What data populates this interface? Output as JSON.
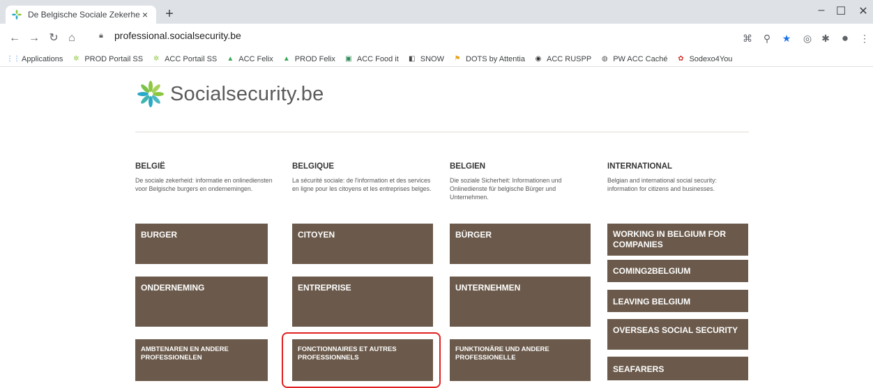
{
  "browser": {
    "tab_title": "De Belgische Sociale Zekerheid |",
    "url": "professional.socialsecurity.be",
    "bookmarks": [
      {
        "label": "Applications",
        "icon": "apps-grid-icon"
      },
      {
        "label": "PROD Portail SS",
        "icon": "socialsecurity-icon"
      },
      {
        "label": "ACC Portail SS",
        "icon": "socialsecurity-icon"
      },
      {
        "label": "ACC Felix",
        "icon": "felix-icon"
      },
      {
        "label": "PROD Felix",
        "icon": "felix-icon"
      },
      {
        "label": "ACC Food it",
        "icon": "food-icon"
      },
      {
        "label": "SNOW",
        "icon": "snow-icon"
      },
      {
        "label": "DOTS by Attentia",
        "icon": "attentia-icon"
      },
      {
        "label": "ACC RUSPP",
        "icon": "ruspp-icon"
      },
      {
        "label": "PW ACC Caché",
        "icon": "globe-icon"
      },
      {
        "label": "Sodexo4You",
        "icon": "sodexo-icon"
      }
    ]
  },
  "site": {
    "name": "Socialsecurity.be"
  },
  "columns": [
    {
      "heading": "BELGIË",
      "description": "De sociale zekerheid: informatie en onlinediensten voor Belgische burgers en ondernemingen.",
      "buttons": [
        "BURGER",
        "ONDERNEMING",
        "AMBTENAREN EN ANDERE PROFESSIONELEN"
      ]
    },
    {
      "heading": "BELGIQUE",
      "description": "La sécurité sociale: de l'information et des services en ligne pour les citoyens et les entreprises belges.",
      "buttons": [
        "CITOYEN",
        "ENTREPRISE",
        "FONCTIONNAIRES ET AUTRES PROFESSIONNELS"
      ]
    },
    {
      "heading": "BELGIEN",
      "description": "Die soziale Sicherheit: Informationen und Onlinedienste für belgische Bürger und Unternehmen.",
      "buttons": [
        "BÜRGER",
        "UNTERNEHMEN",
        "FUNKTIONÄRE UND ANDERE PROFESSIONELLE"
      ]
    },
    {
      "heading": "INTERNATIONAL",
      "description": "Belgian and international social security: information for citizens and businesses.",
      "buttons": [
        "WORKING IN BELGIUM FOR COMPANIES",
        "COMING2BELGIUM",
        "LEAVING BELGIUM",
        "OVERSEAS SOCIAL SECURITY",
        "SEAFARERS"
      ]
    }
  ],
  "colors": {
    "button_bg": "#6b5a4b",
    "highlight": "#e02020"
  }
}
